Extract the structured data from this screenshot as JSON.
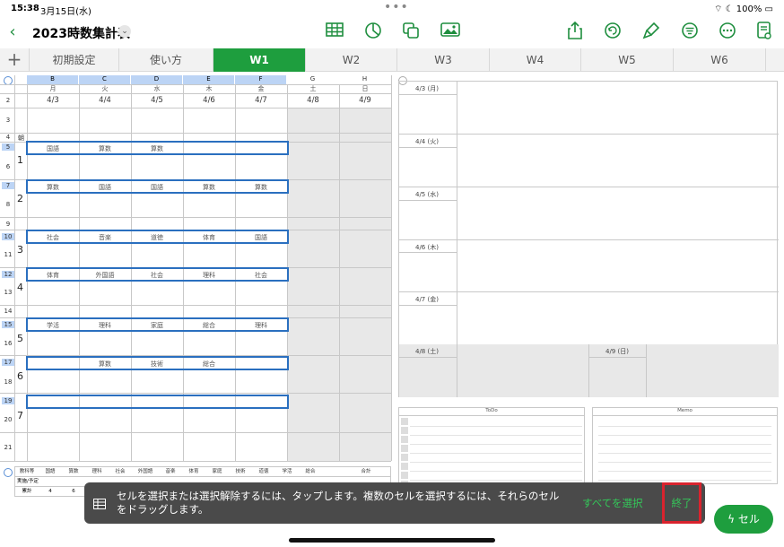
{
  "status": {
    "time": "15:38",
    "date": "3月15日(水)",
    "battery": "100%"
  },
  "toolbar": {
    "title": "2023時数集計表"
  },
  "tabs": [
    "初期設定",
    "使い方",
    "W1",
    "W2",
    "W3",
    "W4",
    "W5",
    "W6"
  ],
  "active_tab": "W1",
  "columns": [
    "B",
    "C",
    "D",
    "E",
    "F",
    "G",
    "H"
  ],
  "days": [
    "月",
    "火",
    "水",
    "木",
    "金",
    "土",
    "日"
  ],
  "dates": [
    "4/3",
    "4/4",
    "4/5",
    "4/6",
    "4/7",
    "4/8",
    "4/9"
  ],
  "rows": [
    "1",
    "2",
    "3",
    "4",
    "5",
    "6",
    "7",
    "8",
    "9",
    "10",
    "11",
    "12",
    "13",
    "14",
    "15",
    "16",
    "17",
    "18",
    "19",
    "20",
    "21"
  ],
  "row4_label": "朝",
  "periods": [
    "1",
    "2",
    "3",
    "4",
    "5",
    "6",
    "7"
  ],
  "subjects": {
    "r5": [
      "国語",
      "算数",
      "算数",
      "",
      ""
    ],
    "r7": [
      "算数",
      "国語",
      "国語",
      "算数",
      "算数"
    ],
    "r10": [
      "社会",
      "音楽",
      "道徳",
      "体育",
      "国語"
    ],
    "r12": [
      "体育",
      "外国語",
      "社会",
      "理科",
      "社会"
    ],
    "r15": [
      "学活",
      "理科",
      "家庭",
      "総合",
      "理科"
    ],
    "r17": [
      "",
      "算数",
      "技術",
      "総合",
      ""
    ]
  },
  "right_panel": {
    "days": [
      "4/3 (月)",
      "4/4 (火)",
      "4/5 (水)",
      "4/6 (木)",
      "4/7 (金)"
    ],
    "sat": "4/8 (土)",
    "sun": "4/9 (日)",
    "todo": "ToDo",
    "memo": "Memo"
  },
  "summary": {
    "headers": [
      "教科等",
      "国語",
      "算数",
      "理科",
      "社会",
      "外国語",
      "音楽",
      "体育",
      "家庭",
      "技術",
      "道徳",
      "学活",
      "総合",
      "",
      "合計"
    ],
    "row2_label": "実施/予定",
    "row3_label": "累計",
    "row3_values": [
      "4",
      "6"
    ]
  },
  "hint": {
    "text": "セルを選択または選択解除するには、タップします。複数のセルを選択するには、それらのセルをドラッグします。",
    "select_all": "すべてを選択",
    "done": "終了"
  },
  "cell_button": "セル"
}
